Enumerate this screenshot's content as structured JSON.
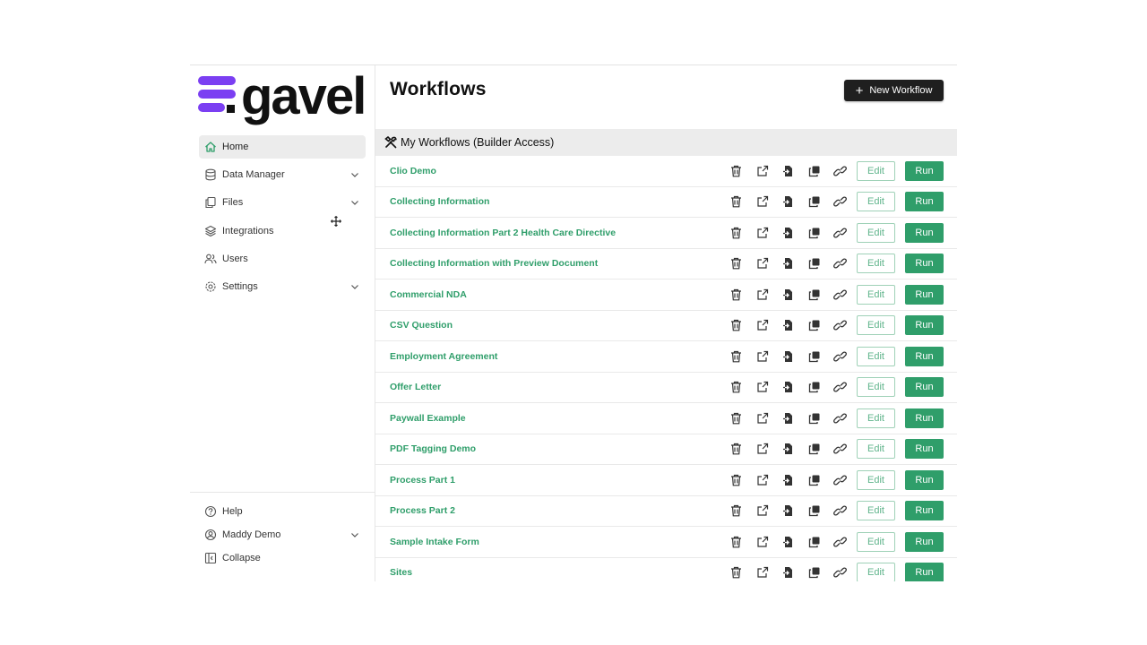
{
  "brand": {
    "name": "gavel",
    "color": "#7b3ff2"
  },
  "accent": "#2f9e6a",
  "nav": {
    "items": [
      {
        "label": "Home",
        "icon": "home-icon",
        "active": true,
        "expandable": false
      },
      {
        "label": "Data Manager",
        "icon": "database-icon",
        "active": false,
        "expandable": true
      },
      {
        "label": "Files",
        "icon": "files-icon",
        "active": false,
        "expandable": true
      },
      {
        "label": "Integrations",
        "icon": "layers-icon",
        "active": false,
        "expandable": false
      },
      {
        "label": "Users",
        "icon": "users-icon",
        "active": false,
        "expandable": false
      },
      {
        "label": "Settings",
        "icon": "gear-icon",
        "active": false,
        "expandable": true
      }
    ],
    "bottom": [
      {
        "label": "Help",
        "icon": "help-icon",
        "expandable": false
      },
      {
        "label": "Maddy Demo",
        "icon": "user-circle-icon",
        "expandable": true
      },
      {
        "label": "Collapse",
        "icon": "collapse-icon",
        "expandable": false
      }
    ]
  },
  "header": {
    "title": "Workflows",
    "new_button": "New Workflow"
  },
  "section": {
    "title": "My Workflows (Builder Access)"
  },
  "row_actions": {
    "edit_label": "Edit",
    "run_label": "Run",
    "icons": [
      "trash-icon",
      "share-icon",
      "export-icon",
      "duplicate-icon",
      "link-icon"
    ]
  },
  "workflows": [
    {
      "name": "Clio Demo"
    },
    {
      "name": "Collecting Information"
    },
    {
      "name": "Collecting Information Part 2 Health Care Directive"
    },
    {
      "name": "Collecting Information with Preview Document"
    },
    {
      "name": "Commercial NDA"
    },
    {
      "name": "CSV Question"
    },
    {
      "name": "Employment Agreement"
    },
    {
      "name": "Offer Letter"
    },
    {
      "name": "Paywall Example"
    },
    {
      "name": "PDF Tagging Demo"
    },
    {
      "name": "Process Part 1"
    },
    {
      "name": "Process Part 2"
    },
    {
      "name": "Sample Intake Form"
    },
    {
      "name": "Sites"
    }
  ]
}
